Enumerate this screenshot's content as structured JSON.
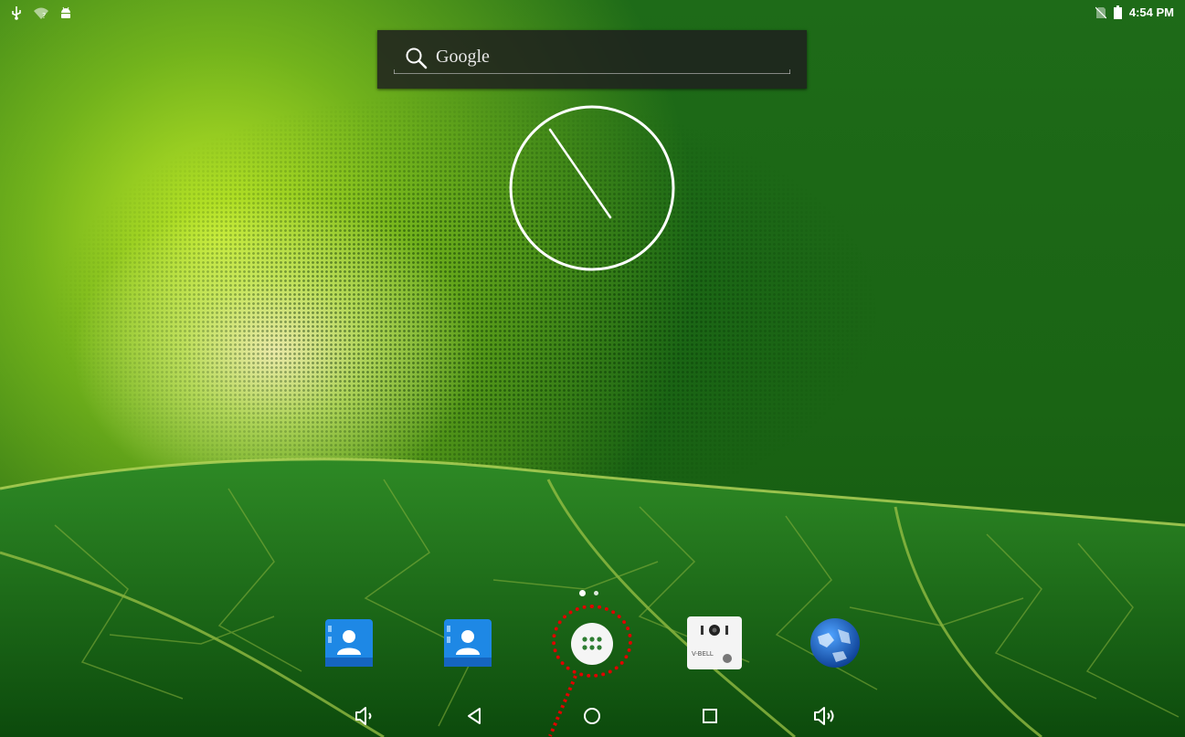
{
  "status_bar": {
    "left_icons": [
      "usb-icon",
      "wifi-unknown-icon",
      "android-debug-icon"
    ],
    "right_icons": [
      "no-sim-icon",
      "battery-icon"
    ],
    "time": "4:54 PM"
  },
  "search_widget": {
    "label": "Google",
    "icon": "search-icon"
  },
  "clock_widget": {
    "type": "analog"
  },
  "page_indicator": {
    "pages": 2,
    "active": 0
  },
  "dock": {
    "apps": [
      {
        "icon": "contacts-icon"
      },
      {
        "icon": "contacts-icon"
      },
      {
        "icon": "all-apps-icon"
      },
      {
        "icon": "v-bell-app-icon",
        "text": "V-BELL"
      },
      {
        "icon": "browser-globe-icon"
      }
    ]
  },
  "nav_bar": {
    "buttons": [
      "volume-down-icon",
      "back-icon",
      "home-icon",
      "recents-icon",
      "volume-up-icon"
    ]
  },
  "colors": {
    "annotation": "#e00000",
    "contacts_blue": "#1e88e5",
    "status_text": "#ffffff"
  }
}
